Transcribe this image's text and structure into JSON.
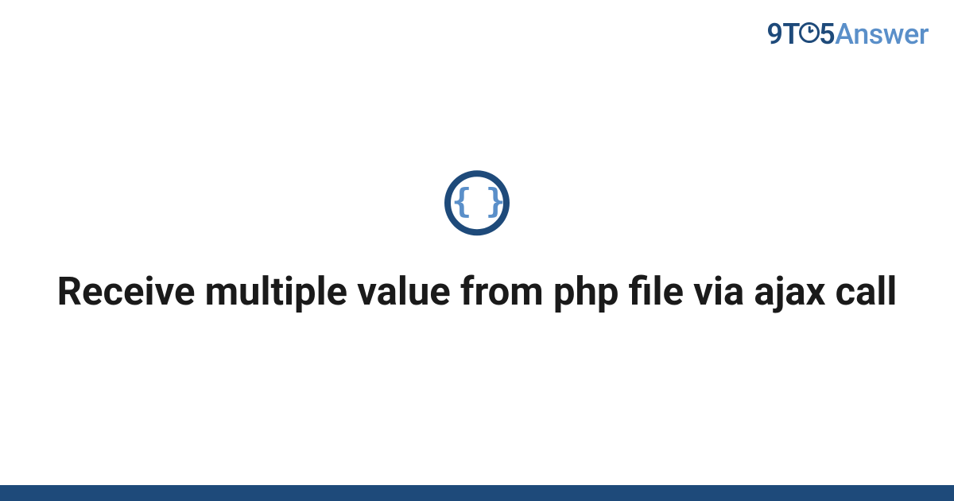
{
  "logo": {
    "part1": "9T",
    "part2": "5",
    "part3": "Answer"
  },
  "icon": {
    "braces": "{ }"
  },
  "title": "Receive multiple value from php file via ajax call",
  "colors": {
    "primary": "#1e4a7a",
    "accent": "#5a8fc9",
    "text": "#1a1a1a",
    "background": "#ffffff"
  }
}
